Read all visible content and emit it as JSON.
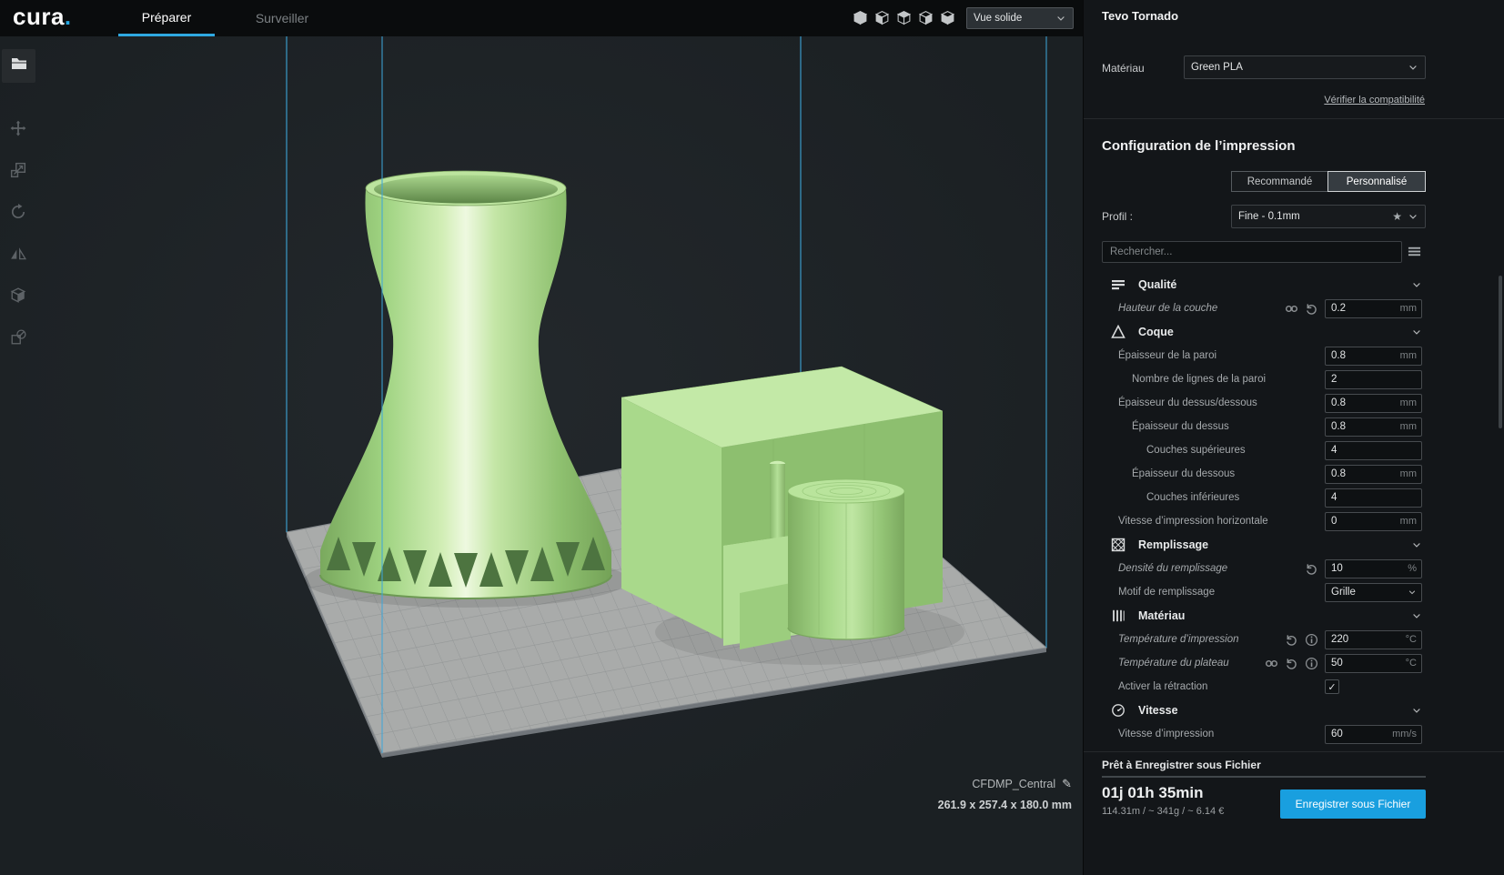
{
  "topbar": {
    "logo_text": "cura",
    "logo_dot": ".",
    "tabs": [
      {
        "label": "Préparer",
        "active": true
      },
      {
        "label": "Surveiller",
        "active": false
      }
    ],
    "view_icons": [
      "view-3d-icon",
      "view-front-icon",
      "view-top-icon",
      "view-left-icon",
      "view-right-icon"
    ],
    "view_mode_dropdown": "Vue solide"
  },
  "left_toolbar": {
    "open_button": "open-file",
    "tools": [
      "move-tool",
      "scale-tool",
      "rotate-tool",
      "mirror-tool",
      "per-model-settings-tool",
      "support-blocker-tool"
    ]
  },
  "viewport": {
    "model_name": "CFDMP_Central",
    "model_dimensions": "261.9 x 257.4 x 180.0 mm",
    "model_color": "#a8d988",
    "plate_color": "#a9abaa",
    "volume_line_color": "#3fa9db"
  },
  "machine_panel": {
    "printer_name": "Tevo Tornado",
    "material_label": "Matériau",
    "material_value": "Green PLA",
    "compatibility_link": "Vérifier la compatibilité"
  },
  "print_setup": {
    "title": "Configuration de l’impression",
    "modes": [
      {
        "label": "Recommandé",
        "active": false
      },
      {
        "label": "Personnalisé",
        "active": true
      }
    ],
    "profile_label": "Profil :",
    "profile_value": "Fine - 0.1mm",
    "search_placeholder": "Rechercher...",
    "settings": [
      {
        "type": "category",
        "key": "quality",
        "icon": "quality",
        "label": "Qualité"
      },
      {
        "type": "setting",
        "key": "layer-height",
        "label": "Hauteur de la couche",
        "italic": true,
        "icons": [
          "link",
          "revert"
        ],
        "value": "0.2",
        "unit": "mm"
      },
      {
        "type": "category",
        "key": "shell",
        "icon": "shell",
        "label": "Coque"
      },
      {
        "type": "setting",
        "key": "wall-thickness",
        "label": "Épaisseur de la paroi",
        "value": "0.8",
        "unit": "mm"
      },
      {
        "type": "setting",
        "key": "wall-line-count",
        "label": "Nombre de lignes de la paroi",
        "indent": 1,
        "value": "2",
        "unit": ""
      },
      {
        "type": "setting",
        "key": "top-bottom-thickness",
        "label": "Épaisseur du dessus/dessous",
        "value": "0.8",
        "unit": "mm"
      },
      {
        "type": "setting",
        "key": "top-thickness",
        "label": "Épaisseur du dessus",
        "indent": 1,
        "value": "0.8",
        "unit": "mm"
      },
      {
        "type": "setting",
        "key": "top-layers",
        "label": "Couches supérieures",
        "indent": 2,
        "value": "4",
        "unit": ""
      },
      {
        "type": "setting",
        "key": "bottom-thickness",
        "label": "Épaisseur du dessous",
        "indent": 1,
        "value": "0.8",
        "unit": "mm"
      },
      {
        "type": "setting",
        "key": "bottom-layers",
        "label": "Couches inférieures",
        "indent": 2,
        "value": "4",
        "unit": ""
      },
      {
        "type": "setting",
        "key": "horizontal-expansion",
        "label": "Vitesse d’impression horizontale",
        "value": "0",
        "unit": "mm"
      },
      {
        "type": "category",
        "key": "infill",
        "icon": "infill",
        "label": "Remplissage"
      },
      {
        "type": "setting",
        "key": "infill-density",
        "label": "Densité du remplissage",
        "italic": true,
        "icons": [
          "revert"
        ],
        "value": "10",
        "unit": "%"
      },
      {
        "type": "setting",
        "key": "infill-pattern",
        "label": "Motif de remplissage",
        "control": "dropdown",
        "value": "Grille"
      },
      {
        "type": "category",
        "key": "material",
        "icon": "material",
        "label": "Matériau"
      },
      {
        "type": "setting",
        "key": "printing-temperature",
        "label": "Température d’impression",
        "italic": true,
        "icons": [
          "revert",
          "info"
        ],
        "value": "220",
        "unit": "°C"
      },
      {
        "type": "setting",
        "key": "build-plate-temperature",
        "label": "Température du plateau",
        "italic": true,
        "icons": [
          "link",
          "revert",
          "info"
        ],
        "value": "50",
        "unit": "°C"
      },
      {
        "type": "setting",
        "key": "enable-retraction",
        "label": "Activer la rétraction",
        "control": "checkbox",
        "checked": true
      },
      {
        "type": "category",
        "key": "speed",
        "icon": "speed",
        "label": "Vitesse"
      },
      {
        "type": "setting",
        "key": "print-speed",
        "label": "Vitesse d’impression",
        "value": "60",
        "unit": "mm/s"
      }
    ]
  },
  "footer": {
    "status": "Prêt à Enregistrer sous Fichier",
    "time_estimate": "01j 01h 35min",
    "material_estimate": "114.31m / ~ 341g / ~ 6.14 €",
    "save_button": "Enregistrer sous Fichier"
  },
  "icons": {
    "star": "★",
    "pencil": "✎",
    "check": "✓"
  },
  "colors": {
    "accent_blue": "#1ea3e0",
    "panel_bg": "#131619",
    "viewport_bg": "#1e2327",
    "topbar_bg": "#0a0c0e"
  }
}
